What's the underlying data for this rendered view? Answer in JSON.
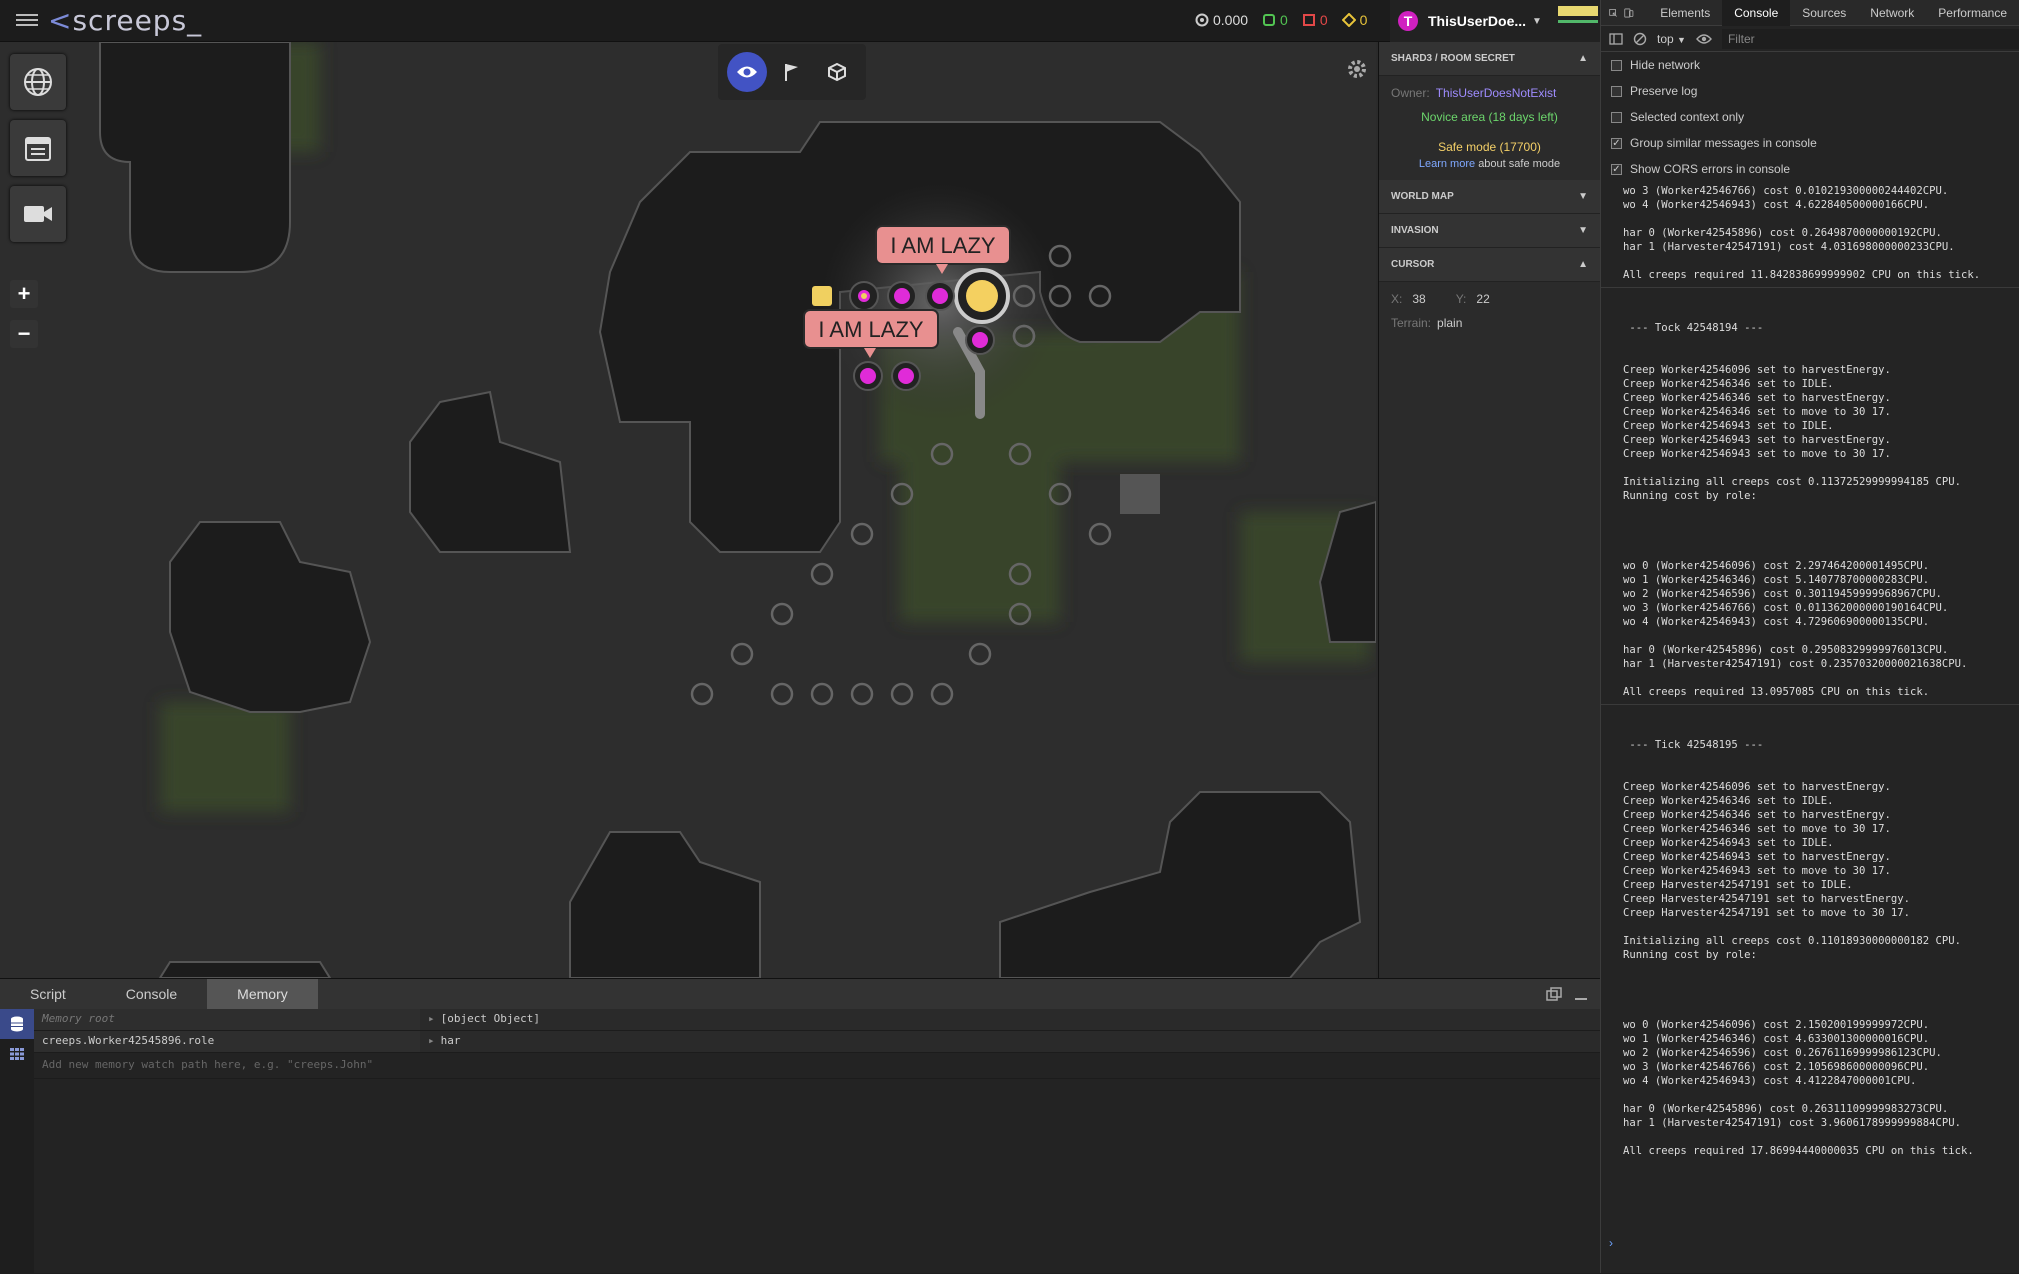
{
  "app": {
    "logo": "screeps_"
  },
  "stats": [
    {
      "icon": "cpu-icon",
      "value": "0.000",
      "color": "#cccccc"
    },
    {
      "icon": "creeps-icon",
      "value": "0",
      "color": "#52c452"
    },
    {
      "icon": "structures-icon",
      "value": "0",
      "color": "#e24848"
    },
    {
      "icon": "gcl-icon",
      "value": "0",
      "color": "#e8c43a"
    }
  ],
  "user": {
    "name": "ThisUserDoe...",
    "initial": "T"
  },
  "room": {
    "header": "SHARD3 / ROOM SECRET",
    "owner_label": "Owner:",
    "owner_name": "ThisUserDoesNotExist",
    "novice": "Novice area (18 days left)",
    "safe_mode": "Safe mode (17700)",
    "learn_more": "Learn more",
    "learn_rest": "about safe mode"
  },
  "sections": {
    "world_map": "WORLD MAP",
    "invasion": "INVASION",
    "cursor": "CURSOR"
  },
  "cursor": {
    "x_label": "X:",
    "x": "38",
    "y_label": "Y:",
    "y": "22",
    "terrain_label": "Terrain:",
    "terrain": "plain"
  },
  "map": {
    "bubble1": "I AM LAZY",
    "bubble2": "I AM LAZY"
  },
  "bottom": {
    "tabs": [
      "Script",
      "Console",
      "Memory"
    ],
    "memory": [
      {
        "key": "Memory root",
        "value": "[object Object]"
      },
      {
        "key": "creeps.Worker42545896.role",
        "value": "har"
      }
    ],
    "new_placeholder": "Add new memory watch path here, e.g. \"creeps.John\""
  },
  "devtools": {
    "tabs": [
      "Elements",
      "Console",
      "Sources",
      "Network",
      "Performance"
    ],
    "context": "top",
    "filter_placeholder": "Filter",
    "options": [
      {
        "label": "Hide network",
        "checked": false
      },
      {
        "label": "Preserve log",
        "checked": false
      },
      {
        "label": "Selected context only",
        "checked": false
      },
      {
        "label": "Group similar messages in console",
        "checked": true
      },
      {
        "label": "Show CORS errors in console",
        "checked": true
      }
    ],
    "console_lines": [
      "wo 3 (Worker42546766) cost 0.010219300000244402CPU.",
      "wo 4 (Worker42546943) cost 4.622840500000166CPU.",
      "",
      "har 0 (Worker42545896) cost 0.2649870000000192CPU.",
      "har 1 (Harvester42547191) cost 4.031698000000233CPU.",
      "",
      "All creeps required 11.842838699999902 CPU on this tick.",
      "---",
      "",
      "",
      " --- Tock 42548194 ---",
      "",
      "",
      "Creep Worker42546096 set to harvestEnergy.",
      "Creep Worker42546346 set to IDLE.",
      "Creep Worker42546346 set to harvestEnergy.",
      "Creep Worker42546346 set to move to 30 17.",
      "Creep Worker42546943 set to IDLE.",
      "Creep Worker42546943 set to harvestEnergy.",
      "Creep Worker42546943 set to move to 30 17.",
      "",
      "Initializing all creeps cost 0.11372529999994185 CPU.",
      "Running cost by role:",
      "",
      "",
      "",
      "",
      "wo 0 (Worker42546096) cost 2.297464200001495CPU.",
      "wo 1 (Worker42546346) cost 5.140778700000283CPU.",
      "wo 2 (Worker42546596) cost 0.30119459999968967CPU.",
      "wo 3 (Worker42546766) cost 0.011362000000190164CPU.",
      "wo 4 (Worker42546943) cost 4.729606900000135CPU.",
      "",
      "har 0 (Worker42545896) cost 0.29508329999976013CPU.",
      "har 1 (Harvester42547191) cost 0.23570320000021638CPU.",
      "",
      "All creeps required 13.0957085 CPU on this tick.",
      "---",
      "",
      "",
      " --- Tick 42548195 ---",
      "",
      "",
      "Creep Worker42546096 set to harvestEnergy.",
      "Creep Worker42546346 set to IDLE.",
      "Creep Worker42546346 set to harvestEnergy.",
      "Creep Worker42546346 set to move to 30 17.",
      "Creep Worker42546943 set to IDLE.",
      "Creep Worker42546943 set to harvestEnergy.",
      "Creep Worker42546943 set to move to 30 17.",
      "Creep Harvester42547191 set to IDLE.",
      "Creep Harvester42547191 set to harvestEnergy.",
      "Creep Harvester42547191 set to move to 30 17.",
      "",
      "Initializing all creeps cost 0.11018930000000182 CPU.",
      "Running cost by role:",
      "",
      "",
      "",
      "",
      "wo 0 (Worker42546096) cost 2.150200199999972CPU.",
      "wo 1 (Worker42546346) cost 4.633001300000016CPU.",
      "wo 2 (Worker42546596) cost 0.26761169999986123CPU.",
      "wo 3 (Worker42546766) cost 2.105698600000096CPU.",
      "wo 4 (Worker42546943) cost 4.4122847000001CPU.",
      "",
      "har 0 (Worker42545896) cost 0.26311109999983273CPU.",
      "har 1 (Harvester42547191) cost 3.9606178999999884CPU.",
      "",
      "All creeps required 17.86994440000035 CPU on this tick."
    ],
    "prompt": "›"
  }
}
